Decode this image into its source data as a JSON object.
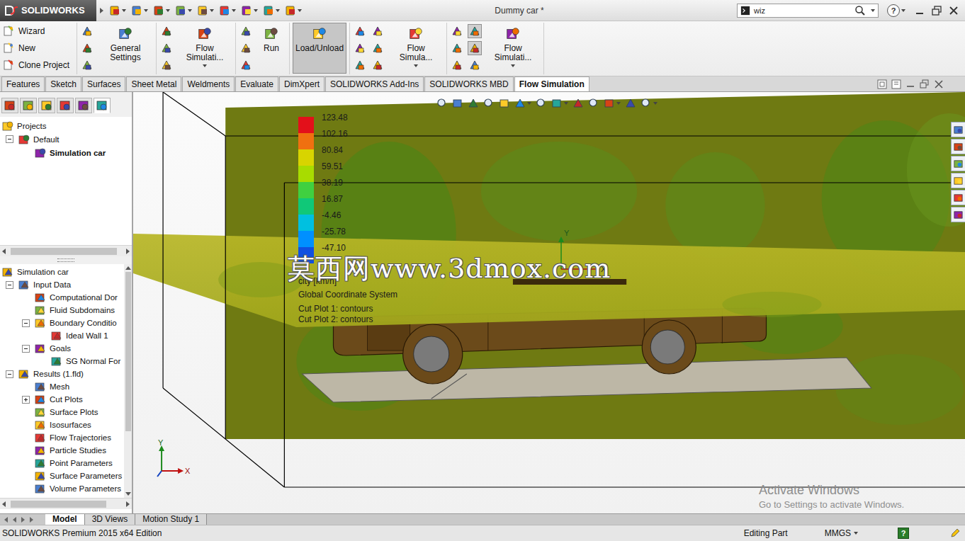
{
  "window": {
    "app": "SOLIDWORKS",
    "title": "Dummy car *"
  },
  "search": {
    "value": "wiz"
  },
  "help": "?",
  "ribbon": {
    "groups": [
      {
        "items": [
          {
            "kind": "stack",
            "labels": [
              "Wizard",
              "New",
              "Clone Project"
            ]
          }
        ]
      },
      {
        "items": [
          {
            "kind": "icons",
            "icons": [
              {
                "selected": false
              },
              {
                "selected": false
              },
              {
                "selected": false
              }
            ]
          },
          {
            "kind": "big",
            "label": "General Settings",
            "dropdown": false,
            "selected": false
          }
        ]
      },
      {
        "items": [
          {
            "kind": "icons",
            "icons": [
              {
                "selected": false
              },
              {
                "selected": false
              },
              {
                "selected": false
              }
            ]
          },
          {
            "kind": "big",
            "label": "Flow Simulati...",
            "dropdown": true,
            "selected": false
          }
        ]
      },
      {
        "items": [
          {
            "kind": "icons",
            "icons": [
              {
                "selected": false
              },
              {
                "selected": false
              },
              {
                "selected": false
              }
            ]
          },
          {
            "kind": "big",
            "label": "Run",
            "dropdown": false,
            "selected": false
          }
        ]
      },
      {
        "items": [
          {
            "kind": "big",
            "label": "Load/Unload",
            "dropdown": false,
            "selected": true
          }
        ]
      },
      {
        "items": [
          {
            "kind": "icons",
            "icons": [
              {
                "selected": false
              },
              {
                "selected": false
              },
              {
                "selected": false
              }
            ]
          },
          {
            "kind": "icons",
            "icons": [
              {
                "selected": false
              },
              {
                "selected": false
              },
              {
                "selected": false
              }
            ]
          },
          {
            "kind": "big",
            "label": "Flow Simula...",
            "dropdown": true,
            "selected": false
          }
        ]
      },
      {
        "items": [
          {
            "kind": "icons",
            "icons": [
              {
                "selected": false
              },
              {
                "selected": false
              },
              {
                "selected": false
              }
            ]
          },
          {
            "kind": "icons",
            "icons": [
              {
                "selected": true
              },
              {
                "selected": true
              },
              {
                "selected": false
              }
            ]
          },
          {
            "kind": "big",
            "label": "Flow Simulati...",
            "dropdown": true,
            "selected": false
          }
        ]
      }
    ]
  },
  "tabs": [
    {
      "label": "Features",
      "selected": false
    },
    {
      "label": "Sketch",
      "selected": false
    },
    {
      "label": "Surfaces",
      "selected": false
    },
    {
      "label": "Sheet Metal",
      "selected": false
    },
    {
      "label": "Weldments",
      "selected": false
    },
    {
      "label": "Evaluate",
      "selected": false
    },
    {
      "label": "DimXpert",
      "selected": false
    },
    {
      "label": "SOLIDWORKS Add-Ins",
      "selected": false
    },
    {
      "label": "SOLIDWORKS MBD",
      "selected": false
    },
    {
      "label": "Flow Simulation",
      "selected": true
    }
  ],
  "panel_tabs": [
    {
      "selected": false
    },
    {
      "selected": false
    },
    {
      "selected": false
    },
    {
      "selected": false
    },
    {
      "selected": false
    },
    {
      "selected": true
    }
  ],
  "project_tree": [
    {
      "label": "Projects",
      "depth": 0,
      "expandable": false,
      "expanded": false,
      "active": false
    },
    {
      "label": "Default",
      "depth": 1,
      "expandable": true,
      "expanded": true,
      "active": false
    },
    {
      "label": "Simulation car",
      "depth": 2,
      "expandable": false,
      "expanded": false,
      "active": true
    }
  ],
  "feature_tree": [
    {
      "label": "Simulation car",
      "depth": 0,
      "expandable": false,
      "expanded": false
    },
    {
      "label": "Input Data",
      "depth": 1,
      "expandable": true,
      "expanded": true
    },
    {
      "label": "Computational Dor",
      "depth": 2,
      "expandable": false,
      "expanded": false
    },
    {
      "label": "Fluid Subdomains",
      "depth": 2,
      "expandable": false,
      "expanded": false
    },
    {
      "label": "Boundary Conditio",
      "depth": 2,
      "expandable": true,
      "expanded": true
    },
    {
      "label": "Ideal Wall 1",
      "depth": 3,
      "expandable": false,
      "expanded": false
    },
    {
      "label": "Goals",
      "depth": 2,
      "expandable": true,
      "expanded": true
    },
    {
      "label": "SG Normal For",
      "depth": 3,
      "expandable": false,
      "expanded": false
    },
    {
      "label": "Results (1.fld)",
      "depth": 1,
      "expandable": true,
      "expanded": true
    },
    {
      "label": "Mesh",
      "depth": 2,
      "expandable": false,
      "expanded": false
    },
    {
      "label": "Cut Plots",
      "depth": 2,
      "expandable": true,
      "expanded": false
    },
    {
      "label": "Surface Plots",
      "depth": 2,
      "expandable": false,
      "expanded": false
    },
    {
      "label": "Isosurfaces",
      "depth": 2,
      "expandable": false,
      "expanded": false
    },
    {
      "label": "Flow Trajectories",
      "depth": 2,
      "expandable": false,
      "expanded": false
    },
    {
      "label": "Particle Studies",
      "depth": 2,
      "expandable": false,
      "expanded": false
    },
    {
      "label": "Point Parameters",
      "depth": 2,
      "expandable": false,
      "expanded": false
    },
    {
      "label": "Surface Parameters",
      "depth": 2,
      "expandable": false,
      "expanded": false
    },
    {
      "label": "Volume Parameters",
      "depth": 2,
      "expandable": false,
      "expanded": false
    }
  ],
  "viewport": {
    "legend": {
      "values": [
        {
          "value": "123.48",
          "color": "#e3101a"
        },
        {
          "value": "102.16",
          "color": "#f07010"
        },
        {
          "value": "80.84",
          "color": "#d8d400"
        },
        {
          "value": "59.51",
          "color": "#a8dc00"
        },
        {
          "value": "38.19",
          "color": "#40d040"
        },
        {
          "value": "16.87",
          "color": "#10c878"
        },
        {
          "value": "-4.46",
          "color": "#00c0e0"
        },
        {
          "value": "-25.78",
          "color": "#0090ff"
        },
        {
          "value": "-47.10",
          "color": "#1050e0"
        }
      ],
      "unit": "city [km/h]",
      "lines": [
        "Global Coordinate System",
        "Cut Plot 1: contours",
        "Cut Plot 2: contours"
      ]
    },
    "triads": [
      {
        "x_label": "X",
        "y_label": "Y"
      },
      {
        "x_label": "X",
        "y_label": "Y"
      }
    ],
    "watermark": "莫西网www.3dmox.com",
    "activation": {
      "title": "Activate Windows",
      "subtitle": "Go to Settings to activate Windows."
    }
  },
  "bottom_tabs": [
    {
      "label": "Model",
      "selected": true
    },
    {
      "label": "3D Views",
      "selected": false
    },
    {
      "label": "Motion Study 1",
      "selected": false
    }
  ],
  "status_bar": {
    "edition": "SOLIDWORKS Premium 2015 x64 Edition",
    "mode": "Editing Part",
    "units": "MMGS",
    "help": "?"
  }
}
